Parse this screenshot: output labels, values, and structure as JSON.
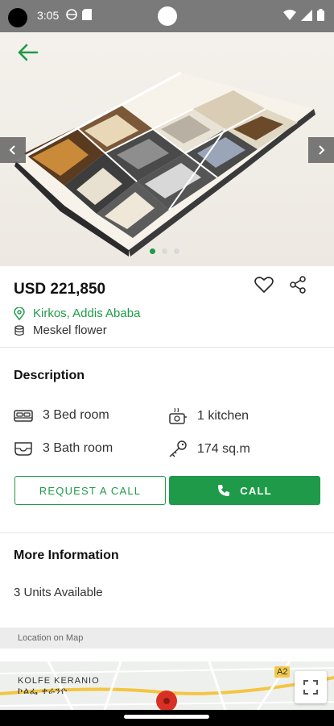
{
  "status": {
    "time": "3:05"
  },
  "listing": {
    "price": "USD 221,850",
    "location": "Kirkos, Addis Ababa",
    "building": "Meskel flower"
  },
  "description": {
    "title": "Description",
    "features": [
      {
        "icon": "bed-icon",
        "label": "3 Bed room"
      },
      {
        "icon": "kitchen-icon",
        "label": "1 kitchen"
      },
      {
        "icon": "bath-icon",
        "label": "3 Bath room"
      },
      {
        "icon": "key-icon",
        "label": "174 sq.m"
      }
    ]
  },
  "actions": {
    "request_label": "REQUEST A CALL",
    "call_label": "CALL"
  },
  "more_info": {
    "title": "More Information",
    "units": "3 Units Available"
  },
  "map": {
    "label": "Location on Map",
    "area_name": "KOLFE KERANIO",
    "area_name_local": "ኮልፌ ቀራንዮ",
    "road_badge": "A2"
  },
  "carousel": {
    "total": 3,
    "active": 1
  },
  "colors": {
    "accent": "#1e9a48",
    "status_bar": "#7a7a7a",
    "pin": "#d93025"
  }
}
